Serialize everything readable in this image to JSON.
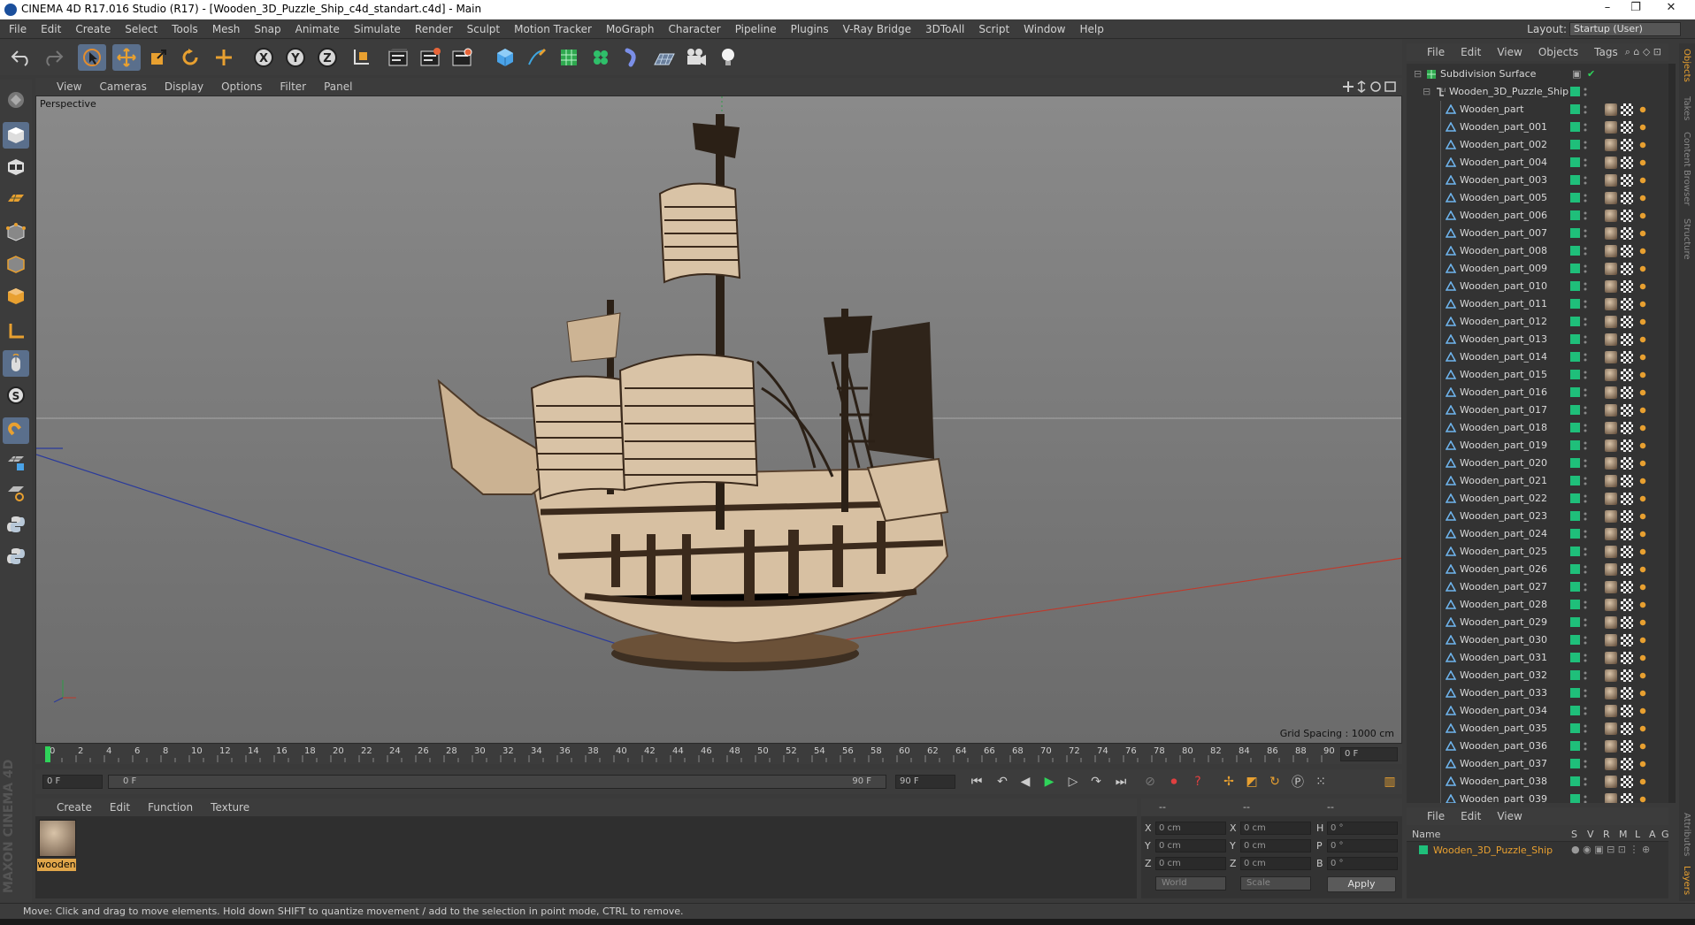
{
  "window": {
    "title": "CINEMA 4D R17.016 Studio (R17) - [Wooden_3D_Puzzle_Ship_c4d_standart.c4d] - Main",
    "controls": [
      "–",
      "❐",
      "✕"
    ]
  },
  "menubar": {
    "items": [
      "File",
      "Edit",
      "Create",
      "Select",
      "Tools",
      "Mesh",
      "Snap",
      "Animate",
      "Simulate",
      "Render",
      "Sculpt",
      "Motion Tracker",
      "MoGraph",
      "Character",
      "Pipeline",
      "Plugins",
      "V-Ray Bridge",
      "3DToAll",
      "Script",
      "Window",
      "Help"
    ],
    "layout_label": "Layout:",
    "layout_value": "Startup (User)"
  },
  "toolbar": {
    "buttons": [
      "undo-icon",
      "redo-icon",
      "live-select-icon",
      "move-icon",
      "scale-icon",
      "rotate-icon",
      "recent-tool-icon",
      "x-axis-icon",
      "y-axis-icon",
      "z-axis-icon",
      "coordinate-system-icon",
      "render-view-icon",
      "render-picture-viewer-icon",
      "edit-render-settings-icon",
      "cube-icon",
      "pen-icon",
      "subdivision-icon",
      "mograph-cloner-icon",
      "deformer-icon",
      "floor-icon",
      "camera-icon",
      "light-icon"
    ],
    "axis_labels": [
      "X",
      "Y",
      "Z"
    ]
  },
  "viewport": {
    "menu": [
      "View",
      "Cameras",
      "Display",
      "Options",
      "Filter",
      "Panel"
    ],
    "label": "Perspective",
    "grid_spacing": "Grid Spacing : 1000 cm"
  },
  "timeline": {
    "ticks": [
      "0",
      "2",
      "4",
      "6",
      "8",
      "10",
      "12",
      "14",
      "16",
      "18",
      "20",
      "22",
      "24",
      "26",
      "28",
      "30",
      "32",
      "34",
      "36",
      "38",
      "40",
      "42",
      "44",
      "46",
      "48",
      "50",
      "52",
      "54",
      "56",
      "58",
      "60",
      "62",
      "64",
      "66",
      "68",
      "70",
      "72",
      "74",
      "76",
      "78",
      "80",
      "82",
      "84",
      "86",
      "88",
      "90"
    ],
    "current_frame": "0 F",
    "start_field": "0 F",
    "range_start": "0 F",
    "range_end": "90 F",
    "end_field": "90 F"
  },
  "material_manager": {
    "menu": [
      "Create",
      "Edit",
      "Function",
      "Texture"
    ],
    "material_name": "wooden"
  },
  "coordinates": {
    "header": [
      "--",
      "--",
      "--"
    ],
    "rows": [
      {
        "label": "X",
        "pos": "0 cm",
        "label2": "X",
        "size": "0 cm",
        "label3": "H",
        "rot": "0 °"
      },
      {
        "label": "Y",
        "pos": "0 cm",
        "label2": "Y",
        "size": "0 cm",
        "label3": "P",
        "rot": "0 °"
      },
      {
        "label": "Z",
        "pos": "0 cm",
        "label2": "Z",
        "size": "0 cm",
        "label3": "B",
        "rot": "0 °"
      }
    ],
    "mode": "World",
    "size_mode": "Scale",
    "apply": "Apply"
  },
  "object_manager": {
    "menu": [
      "File",
      "Edit",
      "View",
      "Objects",
      "Tags"
    ],
    "root": "Subdivision Surface",
    "group": "Wooden_3D_Puzzle_Ship",
    "parts": [
      "Wooden_part",
      "Wooden_part_001",
      "Wooden_part_002",
      "Wooden_part_004",
      "Wooden_part_003",
      "Wooden_part_005",
      "Wooden_part_006",
      "Wooden_part_007",
      "Wooden_part_008",
      "Wooden_part_009",
      "Wooden_part_010",
      "Wooden_part_011",
      "Wooden_part_012",
      "Wooden_part_013",
      "Wooden_part_014",
      "Wooden_part_015",
      "Wooden_part_016",
      "Wooden_part_017",
      "Wooden_part_018",
      "Wooden_part_019",
      "Wooden_part_020",
      "Wooden_part_021",
      "Wooden_part_022",
      "Wooden_part_023",
      "Wooden_part_024",
      "Wooden_part_025",
      "Wooden_part_026",
      "Wooden_part_027",
      "Wooden_part_028",
      "Wooden_part_029",
      "Wooden_part_030",
      "Wooden_part_031",
      "Wooden_part_032",
      "Wooden_part_033",
      "Wooden_part_034",
      "Wooden_part_035",
      "Wooden_part_036",
      "Wooden_part_037",
      "Wooden_part_038",
      "Wooden_part_039"
    ]
  },
  "side_tabs": [
    "Objects",
    "Takes",
    "Content Browser",
    "Structure"
  ],
  "side_tabs_bottom": [
    "Attributes",
    "Layers"
  ],
  "layer_manager": {
    "menu": [
      "File",
      "Edit",
      "View"
    ],
    "columns": [
      "Name",
      "S",
      "V",
      "R",
      "M",
      "L",
      "A",
      "G"
    ],
    "layer_name": "Wooden_3D_Puzzle_Ship"
  },
  "status": "Move: Click and drag to move elements. Hold down SHIFT to quantize movement / add to the selection in point mode, CTRL to remove.",
  "brand": "MAXON CINEMA 4D",
  "colors": {
    "layer_green": "#1fbf7a",
    "material_label": "#e1a64a",
    "selected_tool": "#5a6f8c",
    "x_axis": "#c0392b",
    "z_axis": "#2a3a9c"
  }
}
